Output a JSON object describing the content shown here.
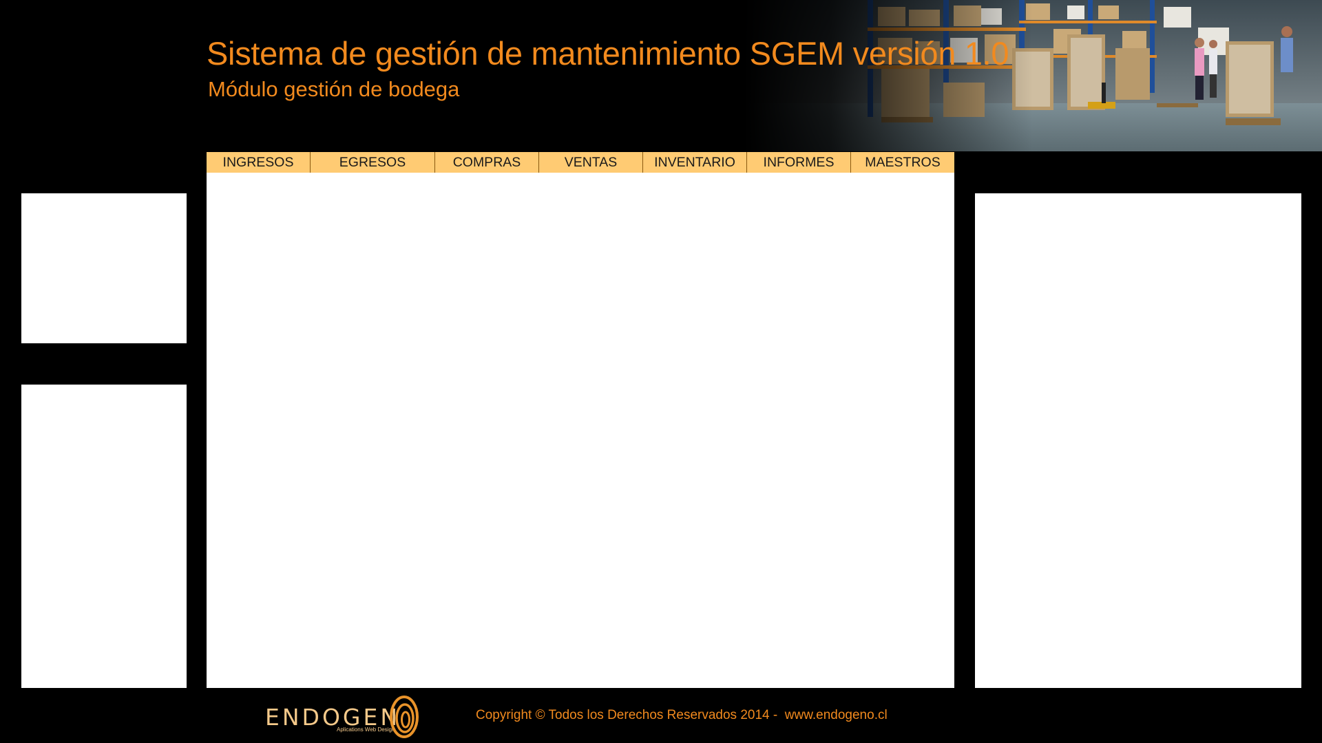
{
  "header": {
    "title": "Sistema de gestión de mantenimiento SGEM versión 1.0",
    "subtitle": "Módulo gestión de bodega",
    "banner_image": "warehouse-photo"
  },
  "nav": {
    "tabs": [
      {
        "label": "INGRESOS"
      },
      {
        "label": "EGRESOS"
      },
      {
        "label": "COMPRAS"
      },
      {
        "label": "VENTAS"
      },
      {
        "label": "INVENTARIO"
      },
      {
        "label": "INFORMES"
      },
      {
        "label": "MAESTROS"
      }
    ]
  },
  "footer": {
    "logo_word": "ENDOGEN",
    "logo_tagline": "Aplications Web Design",
    "copyright": "Copyright © Todos los Derechos Reservados 2014 -  www.endogeno.cl"
  },
  "colors": {
    "background": "#000000",
    "accent_orange": "#f28a1e",
    "nav_tab": "#ffcb73",
    "panel": "#ffffff"
  }
}
